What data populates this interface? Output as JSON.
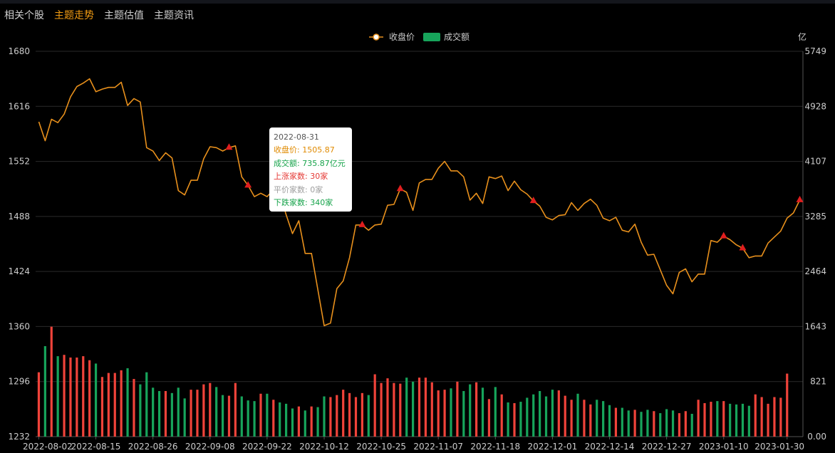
{
  "tabs": [
    {
      "label": "相关个股",
      "active": false
    },
    {
      "label": "主题走势",
      "active": true
    },
    {
      "label": "主题估值",
      "active": false
    },
    {
      "label": "主题资讯",
      "active": false
    }
  ],
  "legend": {
    "close_label": "收盘价",
    "volume_label": "成交额"
  },
  "colors": {
    "line": "#e8901c",
    "up": "#f0433a",
    "down": "#17a45b",
    "marker": "#e01e1e",
    "grid": "#2a2a2a",
    "active_tab": "#f39c12"
  },
  "tooltip": {
    "date": "2022-08-31",
    "close": "收盘价: 1505.87",
    "volume": "成交额: 735.87亿元",
    "up_count": "上涨家数: 30家",
    "flat_count": "平价家数: 0家",
    "down_count": "下跌家数: 340家"
  },
  "chart_data": {
    "type": "line",
    "left_axis": {
      "ticks": [
        "1680",
        "1616",
        "1552",
        "1488",
        "1424",
        "1360",
        "1296",
        "1232"
      ],
      "range": [
        1232,
        1680
      ]
    },
    "right_axis": {
      "unit": "亿",
      "ticks": [
        "5749",
        "4928",
        "4107",
        "3285",
        "2464",
        "1643",
        "821",
        "0.00"
      ],
      "range": [
        0,
        5749
      ]
    },
    "x_tick_labels": [
      "2022-08-02",
      "2022-08-15",
      "2022-08-26",
      "2022-09-08",
      "2022-09-22",
      "2022-10-12",
      "2022-10-25",
      "2022-11-07",
      "2022-11-18",
      "2022-12-01",
      "2022-12-14",
      "2022-12-27",
      "2023-01-10",
      "2023-01-30"
    ],
    "x_tick_indices": [
      0,
      9,
      18,
      27,
      36,
      45,
      54,
      63,
      72,
      81,
      90,
      99,
      108,
      118
    ],
    "series": [
      {
        "name": "收盘价",
        "kind": "line",
        "values": [
          1598,
          1576,
          1601,
          1597,
          1607,
          1627,
          1639,
          1643,
          1648,
          1633,
          1636,
          1638,
          1638,
          1644,
          1617,
          1625,
          1621,
          1568,
          1564,
          1553,
          1562,
          1556,
          1518,
          1513,
          1530,
          1530,
          1555,
          1569,
          1568,
          1564,
          1568,
          1570,
          1534,
          1524,
          1511,
          1515,
          1511,
          1519,
          1514,
          1490,
          1468,
          1483,
          1445,
          1445,
          1403,
          1361,
          1364,
          1404,
          1413,
          1440,
          1478,
          1478,
          1472,
          1478,
          1479,
          1501,
          1502,
          1520,
          1516,
          1495,
          1527,
          1531,
          1531,
          1544,
          1552,
          1541,
          1541,
          1534,
          1507,
          1515,
          1503,
          1534,
          1532,
          1535,
          1518,
          1529,
          1519,
          1514,
          1506,
          1500,
          1487,
          1484,
          1489,
          1490,
          1504,
          1495,
          1503,
          1508,
          1501,
          1486,
          1483,
          1487,
          1472,
          1470,
          1479,
          1458,
          1443,
          1444,
          1426,
          1408,
          1398,
          1423,
          1427,
          1412,
          1421,
          1421,
          1460,
          1458,
          1465,
          1461,
          1455,
          1451,
          1440,
          1442,
          1442,
          1457,
          1464,
          1471,
          1486,
          1492,
          1507
        ]
      },
      {
        "name": "成交额",
        "kind": "bar",
        "values": [
          960,
          1350,
          1640,
          1200,
          1220,
          1180,
          1180,
          1200,
          1140,
          1090,
          890,
          950,
          950,
          990,
          1020,
          860,
          780,
          960,
          730,
          680,
          680,
          650,
          730,
          570,
          700,
          700,
          780,
          800,
          740,
          620,
          610,
          800,
          600,
          540,
          530,
          640,
          640,
          550,
          510,
          490,
          420,
          450,
          390,
          450,
          440,
          600,
          590,
          620,
          700,
          650,
          590,
          650,
          620,
          930,
          800,
          870,
          800,
          790,
          880,
          820,
          880,
          880,
          810,
          690,
          700,
          720,
          820,
          680,
          780,
          810,
          730,
          560,
          740,
          630,
          510,
          500,
          520,
          580,
          630,
          680,
          600,
          700,
          690,
          610,
          550,
          640,
          550,
          480,
          550,
          530,
          470,
          430,
          430,
          390,
          400,
          370,
          400,
          380,
          350,
          410,
          390,
          350,
          380,
          340,
          550,
          500,
          520,
          530,
          530,
          490,
          480,
          490,
          460,
          630,
          590,
          490,
          590,
          580,
          940
        ]
      }
    ],
    "up_markers": [
      30,
      33,
      51,
      57,
      78,
      108,
      111,
      120
    ]
  }
}
